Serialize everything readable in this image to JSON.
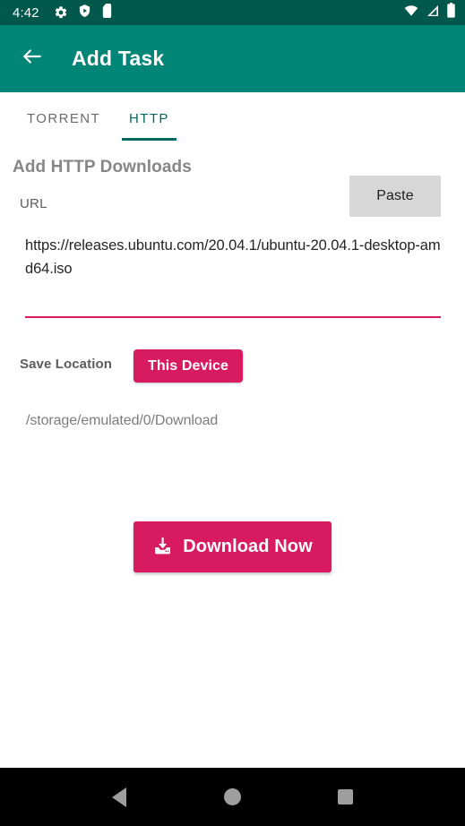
{
  "theme": {
    "status_bar_color": "#00574b",
    "app_bar_color": "#008577",
    "accent_pink": "#d81b60",
    "tab_active_color": "#00695f",
    "paste_button_color": "#d7d7d7",
    "nav_bar_color": "#000000"
  },
  "status_bar": {
    "time": "4:42",
    "left_icons": [
      "gear-icon",
      "shield-play-icon",
      "sd-card-icon"
    ],
    "right_icons": [
      "wifi-icon",
      "cellular-signal-icon",
      "battery-icon"
    ]
  },
  "app_bar": {
    "back_icon": "arrow-left-icon",
    "title": "Add Task"
  },
  "tabs": [
    {
      "label": "TORRENT",
      "active": false
    },
    {
      "label": "HTTP",
      "active": true
    }
  ],
  "main": {
    "section_title": "Add HTTP Downloads",
    "url": {
      "label": "URL",
      "paste_label": "Paste",
      "value": "https://releases.ubuntu.com/20.04.1/ubuntu-20.04.1-desktop-amd64.iso",
      "placeholder": "URL"
    },
    "save_location": {
      "label": "Save Location",
      "button_label": "This Device",
      "path": "/storage/emulated/0/Download"
    },
    "download_button": {
      "label": "Download Now",
      "icon": "download-icon"
    }
  },
  "nav_bar": {
    "back": "back-triangle-icon",
    "home": "home-circle-icon",
    "recents": "recents-square-icon"
  }
}
